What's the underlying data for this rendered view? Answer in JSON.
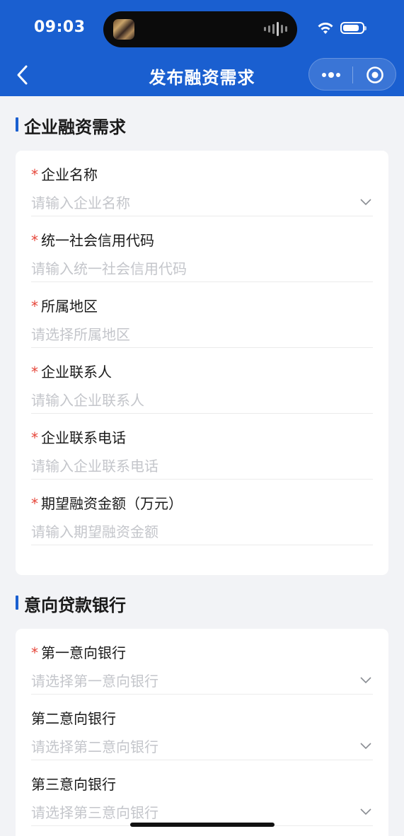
{
  "status_bar": {
    "time": "09:03"
  },
  "header": {
    "title": "发布融资需求"
  },
  "sections": {
    "financing": {
      "title": "企业融资需求",
      "fields": [
        {
          "label": "企业名称",
          "required": "*",
          "placeholder": "请输入企业名称"
        },
        {
          "label": "统一社会信用代码",
          "required": "*",
          "placeholder": "请输入统一社会信用代码"
        },
        {
          "label": "所属地区",
          "required": "*",
          "placeholder": "请选择所属地区"
        },
        {
          "label": "企业联系人",
          "required": "*",
          "placeholder": "请输入企业联系人"
        },
        {
          "label": "企业联系电话",
          "required": "*",
          "placeholder": "请输入企业联系电话"
        },
        {
          "label": "期望融资金额（万元）",
          "required": "*",
          "placeholder": "请输入期望融资金额"
        }
      ]
    },
    "banks": {
      "title": "意向贷款银行",
      "fields": [
        {
          "label": "第一意向银行",
          "required": "*",
          "placeholder": "请选择第一意向银行"
        },
        {
          "label": "第二意向银行",
          "placeholder": "请选择第二意向银行"
        },
        {
          "label": "第三意向银行",
          "placeholder": "请选择第三意向银行"
        }
      ]
    }
  },
  "colors": {
    "primary": "#1a5fd0",
    "required": "#e6463a",
    "placeholder": "#c4c6cb",
    "background": "#f2f3f6"
  },
  "icons": [
    "back-icon",
    "more-icon",
    "target-icon",
    "chevron-down-icon",
    "wifi-icon",
    "battery-icon"
  ]
}
